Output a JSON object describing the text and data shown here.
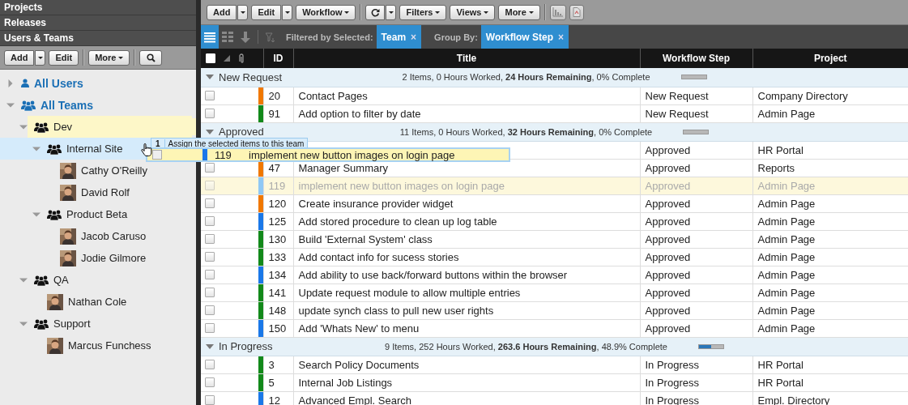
{
  "sidebar": {
    "sections": [
      {
        "label": "Projects"
      },
      {
        "label": "Releases"
      },
      {
        "label": "Users & Teams"
      }
    ],
    "toolbar": [
      {
        "kind": "split",
        "label": "Add"
      },
      {
        "kind": "plain",
        "label": "Edit"
      },
      {
        "kind": "separator"
      },
      {
        "kind": "menu",
        "label": "More"
      },
      {
        "kind": "separator"
      },
      {
        "kind": "search"
      }
    ],
    "tree": [
      {
        "kind": "users",
        "label": "All Users",
        "expanded": false,
        "selected": false,
        "highlighted": false
      },
      {
        "kind": "teams",
        "label": "All Teams",
        "expanded": true,
        "selected": false,
        "highlighted": false,
        "children": [
          {
            "kind": "team",
            "label": "Dev",
            "expanded": true,
            "selected": false,
            "highlighted": true,
            "children": [
              {
                "kind": "team",
                "label": "Internal Site",
                "expanded": true,
                "selected": true,
                "highlighted": false,
                "children": [
                  {
                    "kind": "person",
                    "label": "Cathy O'Reilly",
                    "selected": false,
                    "highlighted": false
                  },
                  {
                    "kind": "person",
                    "label": "David Rolf",
                    "selected": false,
                    "highlighted": false
                  }
                ]
              },
              {
                "kind": "team",
                "label": "Product Beta",
                "expanded": true,
                "selected": false,
                "highlighted": false,
                "children": [
                  {
                    "kind": "person",
                    "label": "Jacob Caruso",
                    "selected": false,
                    "highlighted": false
                  },
                  {
                    "kind": "person",
                    "label": "Jodie Gilmore",
                    "selected": false,
                    "highlighted": false
                  }
                ]
              }
            ]
          },
          {
            "kind": "team",
            "label": "QA",
            "expanded": true,
            "selected": false,
            "highlighted": false,
            "children": [
              {
                "kind": "person",
                "label": "Nathan Cole",
                "selected": false,
                "highlighted": false
              }
            ]
          },
          {
            "kind": "team",
            "label": "Support",
            "expanded": true,
            "selected": false,
            "highlighted": false,
            "children": [
              {
                "kind": "person",
                "label": "Marcus Funchess",
                "selected": false,
                "highlighted": false
              }
            ]
          }
        ]
      }
    ]
  },
  "toolbar": [
    {
      "kind": "split",
      "label": "Add"
    },
    {
      "kind": "split",
      "label": "Edit"
    },
    {
      "kind": "menu",
      "label": "Workflow"
    },
    {
      "kind": "separator"
    },
    {
      "kind": "refresh"
    },
    {
      "kind": "menu",
      "label": "Filters"
    },
    {
      "kind": "menu",
      "label": "Views"
    },
    {
      "kind": "menu",
      "label": "More"
    },
    {
      "kind": "separator"
    },
    {
      "kind": "chart"
    },
    {
      "kind": "export"
    }
  ],
  "filter_bar": {
    "views": [
      {
        "kind": "list",
        "selected": true
      },
      {
        "kind": "grid",
        "selected": false
      },
      {
        "kind": "down",
        "selected": false
      },
      {
        "kind": "sort",
        "selected": false
      }
    ],
    "filter_label": "Filtered by Selected:",
    "filter_chip": {
      "label": "Team",
      "close": "×"
    },
    "group_label": "Group By:",
    "group_chip": {
      "label": "Workflow Step",
      "close": "×"
    }
  },
  "table": {
    "select_all_checked": false,
    "columns": [
      "ID",
      "Title",
      "Workflow Step",
      "Project"
    ],
    "groups": [
      {
        "name": "New Request",
        "expanded": true,
        "summary": "2 Items, 0 Hours Worked, **24 Hours Remaining**, 0% Complete",
        "level": 0,
        "rows": [
          {
            "id": "20",
            "title": "Contact Pages",
            "step": "New Request",
            "project": "Company Directory",
            "color": "#f07800",
            "ghost": false,
            "checked": false
          },
          {
            "id": "91",
            "title": "Add option to filter by date",
            "step": "New Request",
            "project": "Admin Page",
            "color": "#12891a",
            "ghost": false,
            "checked": false
          }
        ]
      },
      {
        "name": "Approved",
        "expanded": true,
        "summary": "11 Items, 0 Hours Worked, **32 Hours Remaining**, 0% Complete",
        "level": 0,
        "rows": [
          {
            "step": "Approved",
            "project": "HR Portal",
            "ghost": false
          },
          {
            "id": "47",
            "title": "Manager Summary",
            "step": "Approved",
            "project": "Reports",
            "color": "#f07800",
            "ghost": false,
            "checked": false
          },
          {
            "id": "119",
            "title": "implement new button images on login page",
            "step": "Approved",
            "project": "Admin Page",
            "color": "#8fc8f5",
            "ghost": true,
            "checked": false
          },
          {
            "id": "120",
            "title": "Create insurance provider widget",
            "step": "Approved",
            "project": "Admin Page",
            "color": "#f07800",
            "ghost": false,
            "checked": false
          },
          {
            "id": "125",
            "title": "Add stored procedure to clean up log table",
            "step": "Approved",
            "project": "Admin Page",
            "color": "#1a78e8",
            "ghost": false,
            "checked": false
          },
          {
            "id": "130",
            "title": "Build 'External System' class",
            "step": "Approved",
            "project": "Admin Page",
            "color": "#12891a",
            "ghost": false,
            "checked": false
          },
          {
            "id": "133",
            "title": "Add contact info for sucess stories",
            "step": "Approved",
            "project": "Admin Page",
            "color": "#12891a",
            "ghost": false,
            "checked": false
          },
          {
            "id": "134",
            "title": "Add ability to use back/forward buttons within the browser",
            "step": "Approved",
            "project": "Admin Page",
            "color": "#1a78e8",
            "ghost": false,
            "checked": false
          },
          {
            "id": "141",
            "title": "Update request module to allow multiple entries",
            "step": "Approved",
            "project": "Admin Page",
            "color": "#12891a",
            "ghost": false,
            "checked": false
          },
          {
            "id": "148",
            "title": "update synch class to pull new user rights",
            "step": "Approved",
            "project": "Admin Page",
            "color": "#12891a",
            "ghost": false,
            "checked": false
          },
          {
            "id": "150",
            "title": "Add 'Whats New' to menu",
            "step": "Approved",
            "project": "Admin Page",
            "color": "#1a78e8",
            "ghost": false,
            "checked": false
          }
        ]
      },
      {
        "name": "In Progress",
        "expanded": true,
        "summary": "9 Items, 252 Hours Worked, **263.6 Hours Remaining**, 48.9% Complete",
        "level": 0.489,
        "rows": [
          {
            "id": "3",
            "title": "Search Policy Documents",
            "step": "In Progress",
            "project": "HR Portal",
            "color": "#12891a",
            "ghost": false,
            "checked": false
          },
          {
            "id": "5",
            "title": "Internal Job Listings",
            "step": "In Progress",
            "project": "HR Portal",
            "color": "#12891a",
            "ghost": false,
            "checked": false
          },
          {
            "id": "12",
            "title": "Advanced Empl. Search",
            "step": "In Progress",
            "project": "Empl. Directory",
            "color": "#1a78e8",
            "ghost": false,
            "checked": false
          }
        ]
      }
    ]
  },
  "drag": {
    "count": "1",
    "tooltip": "Assign the selected items to this team",
    "id": "119",
    "title": "implement new button images on login page",
    "color": "#1a78e8",
    "checked": false
  }
}
